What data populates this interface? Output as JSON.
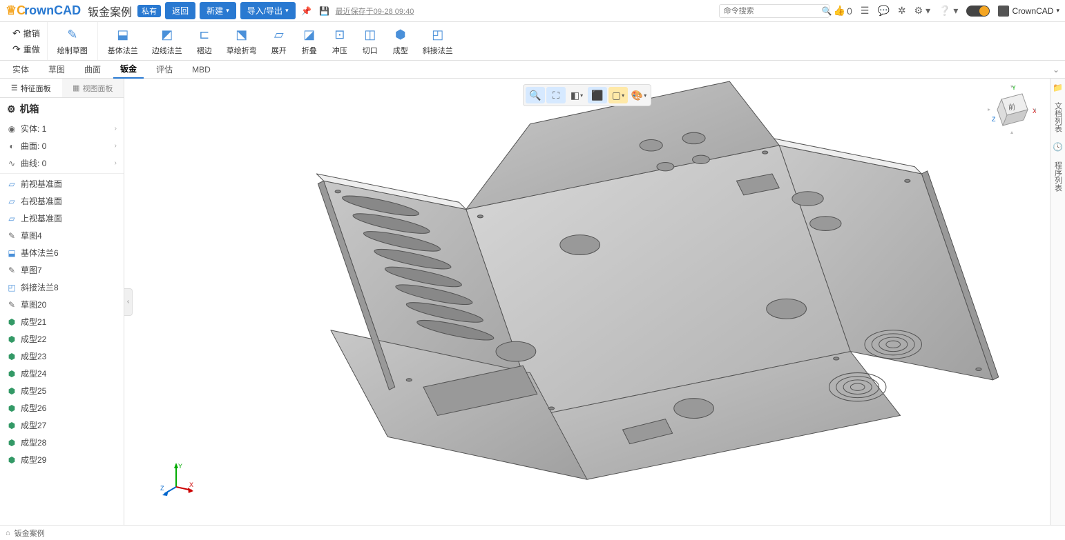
{
  "header": {
    "logo_text": "rownCAD",
    "doc_title": "钣金案例",
    "badge": "私有",
    "btn_back": "返回",
    "btn_new": "新建",
    "btn_import": "导入/导出",
    "save_info": "最近保存于09-28 09:40",
    "search_placeholder": "命令搜索",
    "like_count": "0",
    "user_name": "CrownCAD"
  },
  "ribbon": {
    "undo": "撤销",
    "redo": "重做",
    "sketch": "绘制草图",
    "items": [
      {
        "label": "基体法兰"
      },
      {
        "label": "边线法兰"
      },
      {
        "label": "褶边"
      },
      {
        "label": "草绘折弯"
      },
      {
        "label": "展开"
      },
      {
        "label": "折叠"
      },
      {
        "label": "冲压"
      },
      {
        "label": "切口"
      },
      {
        "label": "成型"
      },
      {
        "label": "斜接法兰"
      }
    ]
  },
  "tabs": {
    "items": [
      "实体",
      "草图",
      "曲面",
      "钣金",
      "评估",
      "MBD"
    ],
    "active": "钣金"
  },
  "panel_tabs": {
    "features": "特征面板",
    "views": "视图面板"
  },
  "part_name": "机箱",
  "tree_counts": {
    "solid": "实体: 1",
    "surface": "曲面: 0",
    "curve": "曲线: 0"
  },
  "tree_planes": [
    "前视基准面",
    "右视基准面",
    "上视基准面"
  ],
  "tree_features": [
    {
      "label": "草图4",
      "icon": "sketch"
    },
    {
      "label": "基体法兰6",
      "icon": "flange"
    },
    {
      "label": "草图7",
      "icon": "sketch"
    },
    {
      "label": "斜接法兰8",
      "icon": "miter"
    },
    {
      "label": "草图20",
      "icon": "sketch"
    },
    {
      "label": "成型21",
      "icon": "form"
    },
    {
      "label": "成型22",
      "icon": "form"
    },
    {
      "label": "成型23",
      "icon": "form"
    },
    {
      "label": "成型24",
      "icon": "form"
    },
    {
      "label": "成型25",
      "icon": "form"
    },
    {
      "label": "成型26",
      "icon": "form"
    },
    {
      "label": "成型27",
      "icon": "form"
    },
    {
      "label": "成型28",
      "icon": "form"
    },
    {
      "label": "成型29",
      "icon": "form"
    }
  ],
  "right_rail": {
    "docs": "文档列表",
    "program": "程序列表"
  },
  "footer": {
    "breadcrumb": "钣金案例"
  },
  "axes": {
    "x": "X",
    "y": "Y",
    "z": "Z"
  },
  "cube_face": "前"
}
